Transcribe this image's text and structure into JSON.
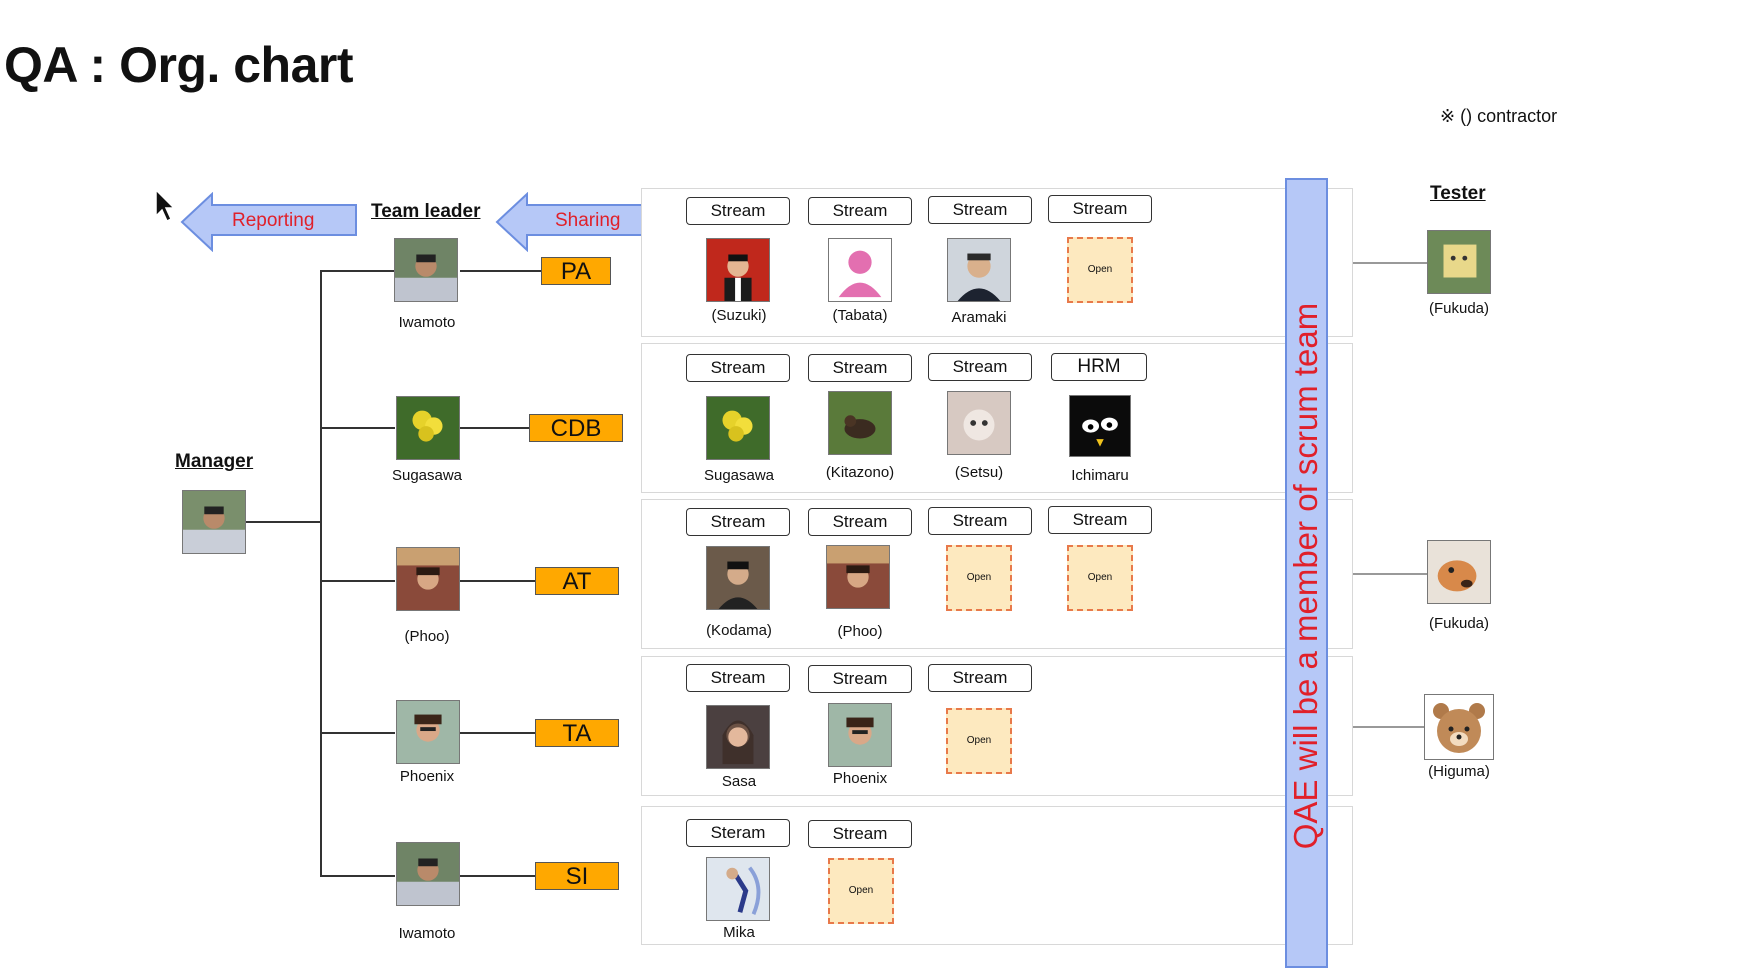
{
  "title": "QA : Org. chart",
  "note": "※ () contractor",
  "headers": {
    "manager": "Manager",
    "team_leader": "Team leader",
    "tester": "Tester"
  },
  "arrows": {
    "reporting": "Reporting",
    "sharing": "Sharing"
  },
  "scrum_note": "QAE will be a member of scrum team",
  "manager": {
    "icon": "person-photo-icon"
  },
  "teams": [
    {
      "code": "PA",
      "leader": "Iwamoto"
    },
    {
      "code": "CDB",
      "leader": "Sugasawa"
    },
    {
      "code": "AT",
      "leader": "(Phoo)"
    },
    {
      "code": "TA",
      "leader": "Phoenix"
    },
    {
      "code": "SI",
      "leader": "Iwamoto"
    }
  ],
  "rows": [
    [
      {
        "role": "Stream",
        "name": "(Suzuki)"
      },
      {
        "role": "Stream",
        "name": "(Tabata)"
      },
      {
        "role": "Stream",
        "name": "Aramaki"
      },
      {
        "role": "Stream",
        "name": "Open"
      }
    ],
    [
      {
        "role": "Stream",
        "name": "Sugasawa"
      },
      {
        "role": "Stream",
        "name": "(Kitazono)"
      },
      {
        "role": "Stream",
        "name": "(Setsu)"
      },
      {
        "role": "HRM",
        "name": "Ichimaru"
      }
    ],
    [
      {
        "role": "Stream",
        "name": "(Kodama)"
      },
      {
        "role": "Stream",
        "name": "(Phoo)"
      },
      {
        "role": "Stream",
        "name": "Open"
      },
      {
        "role": "Stream",
        "name": "Open"
      }
    ],
    [
      {
        "role": "Stream",
        "name": "Sasa"
      },
      {
        "role": "Stream",
        "name": "Phoenix"
      },
      {
        "role": "Stream",
        "name": "Open"
      }
    ],
    [
      {
        "role": "Steram",
        "name": "Mika"
      },
      {
        "role": "Stream",
        "name": "Open"
      }
    ]
  ],
  "testers": [
    {
      "name": "(Fukuda)"
    },
    {
      "name": "(Fukuda)"
    },
    {
      "name": "(Higuma)"
    }
  ],
  "colors": {
    "team_box": "#ffa800",
    "arrow_fill": "#b6c8f7",
    "arrow_text": "#e0202a",
    "open_fill": "#fde9bf",
    "open_border": "#e8794a"
  }
}
